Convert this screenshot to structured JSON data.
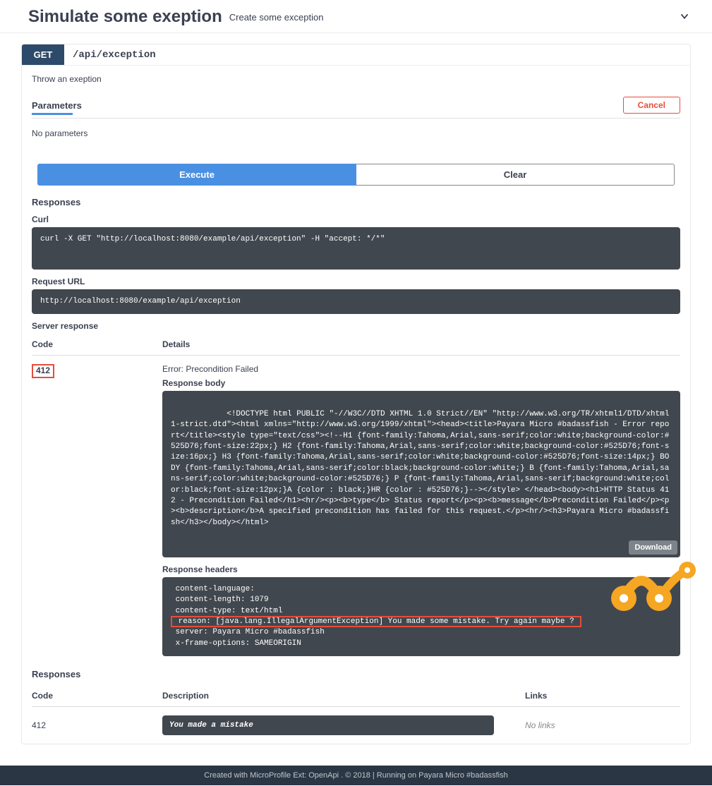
{
  "header": {
    "title": "Simulate some exeption",
    "desc": "Create some exception"
  },
  "op": {
    "method": "GET",
    "path": "/api/exception",
    "summary": "Throw an exeption"
  },
  "params": {
    "title": "Parameters",
    "cancel": "Cancel",
    "none": "No parameters"
  },
  "buttons": {
    "execute": "Execute",
    "clear": "Clear",
    "download": "Download"
  },
  "sections": {
    "responses": "Responses",
    "curl": "Curl",
    "request_url": "Request URL",
    "server_response": "Server response",
    "response_body": "Response body",
    "response_headers": "Response headers"
  },
  "cols": {
    "code": "Code",
    "details": "Details",
    "description": "Description",
    "links": "Links"
  },
  "curl": "curl -X GET \"http://localhost:8080/example/api/exception\" -H \"accept: */*\"",
  "request_url": "http://localhost:8080/example/api/exception",
  "server": {
    "code": "412",
    "error": "Error: Precondition Failed",
    "body": "<!DOCTYPE html PUBLIC \"-//W3C//DTD XHTML 1.0 Strict//EN\" \"http://www.w3.org/TR/xhtml1/DTD/xhtml1-strict.dtd\"><html xmlns=\"http://www.w3.org/1999/xhtml\"><head><title>Payara Micro #badassfish - Error report</title><style type=\"text/css\"><!--H1 {font-family:Tahoma,Arial,sans-serif;color:white;background-color:#525D76;font-size:22px;} H2 {font-family:Tahoma,Arial,sans-serif;color:white;background-color:#525D76;font-size:16px;} H3 {font-family:Tahoma,Arial,sans-serif;color:white;background-color:#525D76;font-size:14px;} BODY {font-family:Tahoma,Arial,sans-serif;color:black;background-color:white;} B {font-family:Tahoma,Arial,sans-serif;color:white;background-color:#525D76;} P {font-family:Tahoma,Arial,sans-serif;background:white;color:black;font-size:12px;}A {color : black;}HR {color : #525D76;}--></style> </head><body><h1>HTTP Status 412 - Precondition Failed</h1><hr/><p><b>type</b> Status report</p><p><b>message</b>Precondition Failed</p><p><b>description</b>A specified precondition has failed for this request.</p><hr/><h3>Payara Micro #badassfish</h3></body></html>",
    "headers_pre": " content-language: \n content-length: 1079 \n content-type: text/html ",
    "headers_reason": " reason: [java.lang.IllegalArgumentException] You made some mistake. Try again maybe ? ",
    "headers_post": " server: Payara Micro #badassfish \n x-frame-options: SAMEORIGIN "
  },
  "doc_responses": {
    "code": "412",
    "desc": "You made a mistake",
    "links": "No links"
  },
  "footer": "Created with MicroProfile Ext: OpenApi . © 2018 | Running on Payara Micro #badassfish"
}
